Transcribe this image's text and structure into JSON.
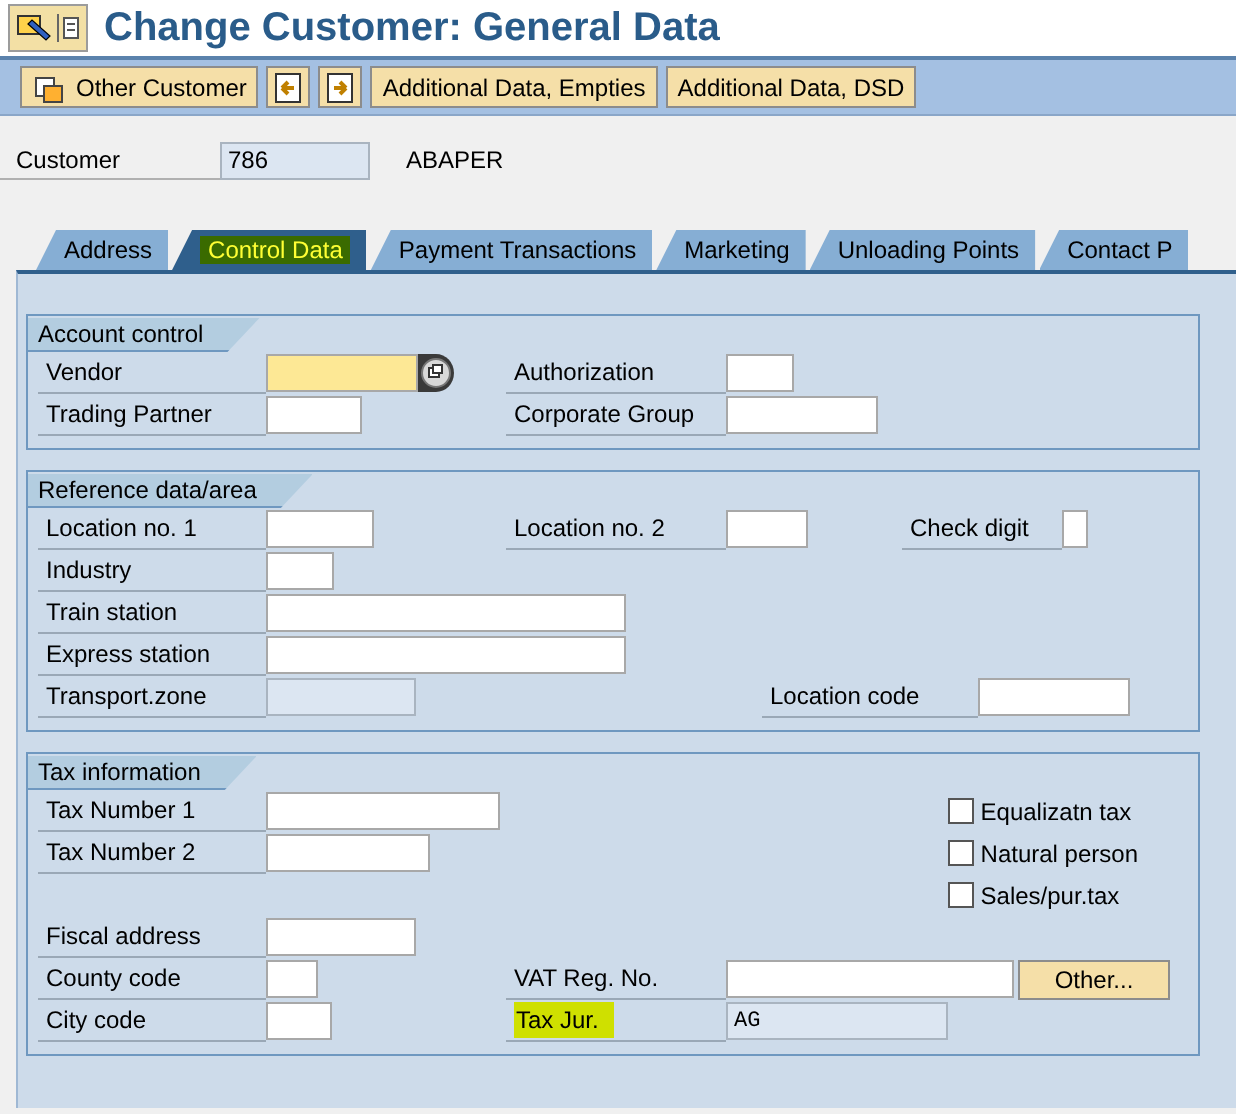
{
  "window": {
    "title": "Change Customer: General Data"
  },
  "toolbar": [
    {
      "kind": "icon-text",
      "label": "Other Customer"
    },
    {
      "kind": "icon"
    },
    {
      "kind": "icon"
    },
    {
      "kind": "text",
      "label": "Additional Data, Empties"
    },
    {
      "kind": "text",
      "label": "Additional Data, DSD"
    }
  ],
  "customer": {
    "label": "Customer",
    "value": "786",
    "name": "ABAPER"
  },
  "tabs": [
    {
      "label": "Address",
      "selected": false
    },
    {
      "label": "Control Data",
      "selected": true,
      "highlighted": true
    },
    {
      "label": "Payment Transactions",
      "selected": false
    },
    {
      "label": "Marketing",
      "selected": false
    },
    {
      "label": "Unloading Points",
      "selected": false
    },
    {
      "label": "Contact P",
      "selected": false
    }
  ],
  "sections": [
    {
      "title": "Account control",
      "rows": [
        [
          {
            "kind": "field",
            "label": "Vendor",
            "required": true,
            "search_help": true
          },
          {
            "kind": "field",
            "label": "Authorization"
          }
        ],
        [
          {
            "kind": "field",
            "label": "Trading Partner"
          },
          {
            "kind": "field",
            "label": "Corporate Group"
          }
        ]
      ]
    },
    {
      "title": "Reference data/area",
      "rows": [
        [
          {
            "kind": "field",
            "label": "Location no. 1"
          },
          {
            "kind": "field",
            "label": "Location no. 2"
          },
          {
            "kind": "field",
            "label": "Check digit"
          }
        ],
        [
          {
            "kind": "field",
            "label": "Industry"
          }
        ],
        [
          {
            "kind": "field",
            "label": "Train station"
          }
        ],
        [
          {
            "kind": "field",
            "label": "Express station"
          }
        ],
        [
          {
            "kind": "readonly",
            "label": "Transport.zone"
          },
          {
            "kind": "field",
            "label": "Location code"
          }
        ]
      ]
    },
    {
      "title": "Tax information",
      "options": [
        {
          "label": "Equalizatn tax",
          "checked": false
        },
        {
          "label": "Natural person",
          "checked": false
        },
        {
          "label": "Sales/pur.tax",
          "checked": false
        }
      ],
      "rows": [
        [
          {
            "kind": "field",
            "label": "Tax Number 1"
          }
        ],
        [
          {
            "kind": "field",
            "label": "Tax Number 2"
          }
        ],
        [
          {
            "kind": "field",
            "label": "Fiscal address"
          }
        ],
        [
          {
            "kind": "field",
            "label": "County code"
          },
          {
            "kind": "field",
            "label": "VAT Reg. No."
          },
          {
            "kind": "button",
            "label": "Other..."
          }
        ],
        [
          {
            "kind": "field",
            "label": "City code"
          },
          {
            "kind": "readonly",
            "label": "Tax Jur.",
            "value": "AG",
            "highlighted": true
          }
        ]
      ]
    }
  ]
}
